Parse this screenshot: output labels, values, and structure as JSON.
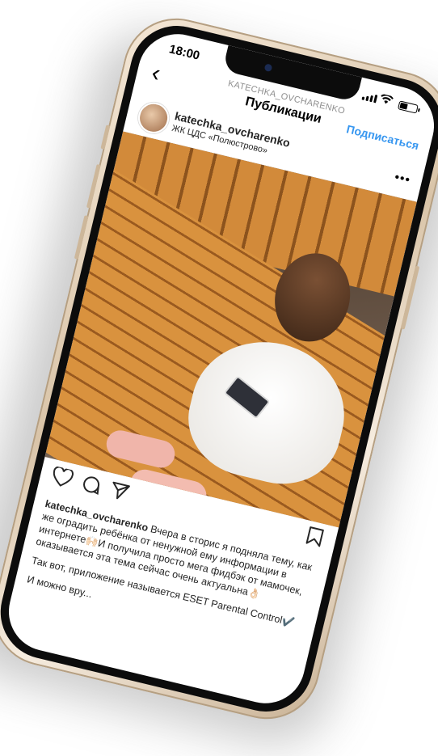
{
  "status_bar": {
    "time": "18:00"
  },
  "header": {
    "username_small": "KATECHKA_OVCHARENKO",
    "title": "Публикации",
    "follow_label": "Подписаться"
  },
  "post": {
    "username": "katechka_ovcharenko",
    "location": "ЖК ЦДС «Полюстрово»",
    "caption_user": "katechka_ovcharenko",
    "caption_text": "Вчера в сторис я подняла тему, как же оградить ребёнка от ненужной ему информации в интернете🙌🏻И получила просто мега фидбэк от мамочек, оказывается эта тема сейчас очень актуальна👌🏻",
    "caption_text2": "Так вот, приложение называется ESET Parental Control✔️",
    "caption_text3": "И можно вру..."
  },
  "icons": {
    "back": "chevron-left-icon",
    "more": "more-horizontal-icon",
    "like": "heart-icon",
    "comment": "comment-icon",
    "share": "send-icon",
    "save": "bookmark-icon"
  },
  "colors": {
    "accent": "#3897f0",
    "frame": "#e6d4bd"
  }
}
